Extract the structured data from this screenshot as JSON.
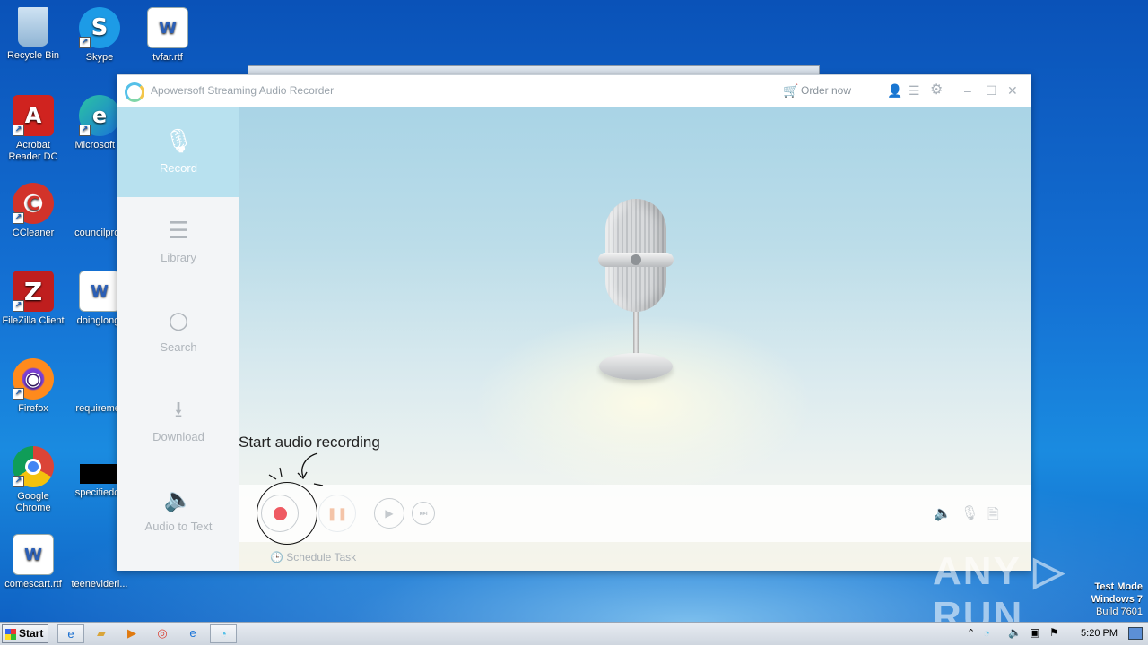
{
  "desktop": {
    "icons": [
      {
        "label": "Recycle Bin",
        "glyph": "🗑"
      },
      {
        "label": "Skype",
        "glyph": "S"
      },
      {
        "label": "tvfar.rtf",
        "glyph": "W"
      },
      {
        "label": "Acrobat Reader DC",
        "glyph": "A"
      },
      {
        "label": "Microsoft E",
        "glyph": "e"
      },
      {
        "label": "CCleaner",
        "glyph": "C"
      },
      {
        "label": "councilproc",
        "glyph": ""
      },
      {
        "label": "FileZilla Client",
        "glyph": "Z"
      },
      {
        "label": "doinglong.",
        "glyph": "W"
      },
      {
        "label": "Firefox",
        "glyph": "◉"
      },
      {
        "label": "requiremer",
        "glyph": ""
      },
      {
        "label": "Google Chrome",
        "glyph": "◎"
      },
      {
        "label": "specifiedcc",
        "glyph": ""
      },
      {
        "label": "comescart.rtf",
        "glyph": "W"
      },
      {
        "label": "teenevideri...",
        "glyph": ""
      }
    ]
  },
  "app": {
    "title": "Apowersoft Streaming Audio Recorder",
    "order_label": "Order now",
    "nav": [
      {
        "label": "Record",
        "glyph": "🎙"
      },
      {
        "label": "Library",
        "glyph": "☰"
      },
      {
        "label": "Search",
        "glyph": "○"
      },
      {
        "label": "Download",
        "glyph": "⭳"
      },
      {
        "label": "Audio to Text",
        "glyph": "🔈"
      }
    ],
    "controls": {
      "pause_glyph": "❚❚",
      "play_glyph": "▶",
      "next_glyph": "⏭",
      "volume_glyph": "🔈",
      "mic_glyph": "🎙",
      "file_glyph": "🗎",
      "schedule_label": "Schedule Task"
    }
  },
  "tooltip": {
    "text": "Start audio recording"
  },
  "taskbar": {
    "start_label": "Start",
    "clock": "5:20 PM"
  },
  "watermark": {
    "brand": "ANY ▷ RUN",
    "line1": "Test Mode",
    "line2": "Windows 7",
    "line3": "Build 7601"
  }
}
